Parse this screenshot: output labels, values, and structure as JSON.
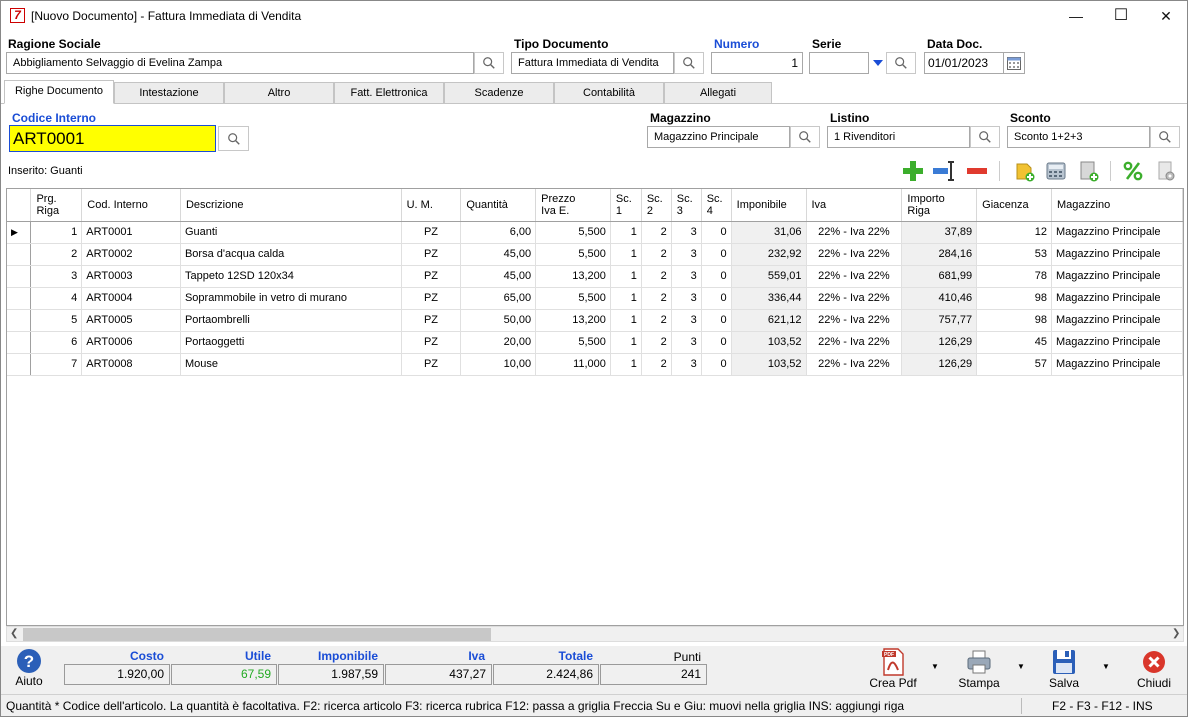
{
  "window": {
    "title": "[Nuovo Documento] - Fattura Immediata di Vendita",
    "app_icon": "7",
    "minimize": "—",
    "maximize": "☐",
    "close": "✕"
  },
  "header": {
    "ragione_sociale_label": "Ragione Sociale",
    "ragione_sociale_value": "Abbigliamento Selvaggio di Evelina Zampa",
    "tipo_documento_label": "Tipo Documento",
    "tipo_documento_value": "Fattura Immediata di Vendita",
    "numero_label": "Numero",
    "numero_value": "1",
    "serie_label": "Serie",
    "serie_value": "",
    "data_label": "Data Doc.",
    "data_value": "01/01/2023"
  },
  "tabs": [
    "Righe Documento",
    "Intestazione",
    "Altro",
    "Fatt. Elettronica",
    "Scadenze",
    "Contabilità",
    "Allegati"
  ],
  "entry": {
    "codice_label": "Codice Interno",
    "codice_value": "ART0001",
    "magazzino_label": "Magazzino",
    "magazzino_value": "Magazzino Principale",
    "listino_label": "Listino",
    "listino_value": "1 Rivenditori",
    "sconto_label": "Sconto",
    "sconto_value": "Sconto 1+2+3",
    "inserito": "Inserito: Guanti"
  },
  "grid": {
    "columns": [
      "Prg. Riga",
      "Cod. Interno",
      "Descrizione",
      "U. M.",
      "Quantità",
      "Prezzo Iva E.",
      "Sc. 1",
      "Sc. 2",
      "Sc. 3",
      "Sc. 4",
      "Imponibile",
      "Iva",
      "Importo Riga",
      "Giacenza",
      "Magazzino"
    ],
    "rows": [
      [
        "1",
        "ART0001",
        "Guanti",
        "PZ",
        "6,00",
        "5,500",
        "1",
        "2",
        "3",
        "0",
        "31,06",
        "22% - Iva 22%",
        "37,89",
        "12",
        "Magazzino Principale"
      ],
      [
        "2",
        "ART0002",
        "Borsa d'acqua calda",
        "PZ",
        "45,00",
        "5,500",
        "1",
        "2",
        "3",
        "0",
        "232,92",
        "22% - Iva 22%",
        "284,16",
        "53",
        "Magazzino Principale"
      ],
      [
        "3",
        "ART0003",
        "Tappeto 12SD 120x34",
        "PZ",
        "45,00",
        "13,200",
        "1",
        "2",
        "3",
        "0",
        "559,01",
        "22% - Iva 22%",
        "681,99",
        "78",
        "Magazzino Principale"
      ],
      [
        "4",
        "ART0004",
        "Soprammobile in vetro di murano",
        "PZ",
        "65,00",
        "5,500",
        "1",
        "2",
        "3",
        "0",
        "336,44",
        "22% - Iva 22%",
        "410,46",
        "98",
        "Magazzino Principale"
      ],
      [
        "5",
        "ART0005",
        "Portaombrelli",
        "PZ",
        "50,00",
        "13,200",
        "1",
        "2",
        "3",
        "0",
        "621,12",
        "22% - Iva 22%",
        "757,77",
        "98",
        "Magazzino Principale"
      ],
      [
        "6",
        "ART0006",
        "Portaoggetti",
        "PZ",
        "20,00",
        "5,500",
        "1",
        "2",
        "3",
        "0",
        "103,52",
        "22% - Iva 22%",
        "126,29",
        "45",
        "Magazzino Principale"
      ],
      [
        "7",
        "ART0008",
        "Mouse",
        "PZ",
        "10,00",
        "11,000",
        "1",
        "2",
        "3",
        "0",
        "103,52",
        "22% - Iva 22%",
        "126,29",
        "57",
        "Magazzino Principale"
      ]
    ]
  },
  "totals": {
    "costo_label": "Costo",
    "costo_value": "1.920,00",
    "utile_label": "Utile",
    "utile_value": "67,59",
    "imponibile_label": "Imponibile",
    "imponibile_value": "1.987,59",
    "iva_label": "Iva",
    "iva_value": "437,27",
    "totale_label": "Totale",
    "totale_value": "2.424,86",
    "punti_label": "Punti",
    "punti_value": "241"
  },
  "buttons": {
    "aiuto": "Aiuto",
    "crea_pdf": "Crea Pdf",
    "stampa": "Stampa",
    "salva": "Salva",
    "chiudi": "Chiudi",
    "pdf_badge": "PDF"
  },
  "status": {
    "hint": "Quantità * Codice dell'articolo. La quantità è facoltativa. F2: ricerca articolo F3: ricerca rubrica F12: passa a griglia Freccia Su e Giu: muovi nella griglia INS: aggiungi riga",
    "keys": "F2 - F3 - F12 - INS"
  },
  "colors": {
    "label_blue": "#1a4dd6",
    "code_yellow": "#ffff00",
    "utile_green": "#22aa22"
  }
}
